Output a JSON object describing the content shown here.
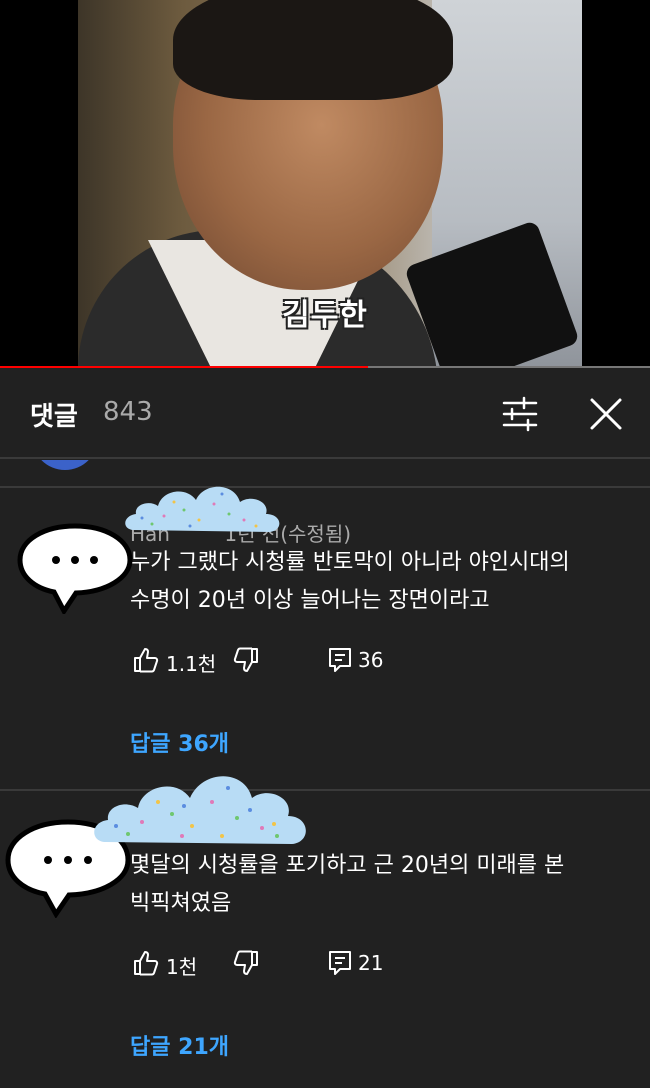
{
  "video": {
    "subtitle": "김두한",
    "progress_fraction": 0.566
  },
  "comments_header": {
    "title": "댓글",
    "count": "843",
    "filter_icon": "sort-filter-icon",
    "close_icon": "close-icon"
  },
  "comments": [
    {
      "author": "Han",
      "time": "1년 전(수정됨)",
      "lines": [
        "누가 그랬다 시청률 반토막이 아니라 야인시대의",
        "수명이 20년 이상 늘어나는 장면이라고"
      ],
      "likes": "1.1천",
      "reply_count": "36",
      "replies_label": "답글 36개"
    },
    {
      "author": "",
      "time": "",
      "lines": [
        "몇달의 시청률을 포기하고 근 20년의 미래를 본",
        "빅픽쳐였음"
      ],
      "likes": "1천",
      "reply_count": "21",
      "replies_label": "답글 21개"
    }
  ],
  "colors": {
    "background": "#212121",
    "link": "#3ea6ff",
    "progress": "#ff0000",
    "secondary_text": "#aaaaaa"
  }
}
